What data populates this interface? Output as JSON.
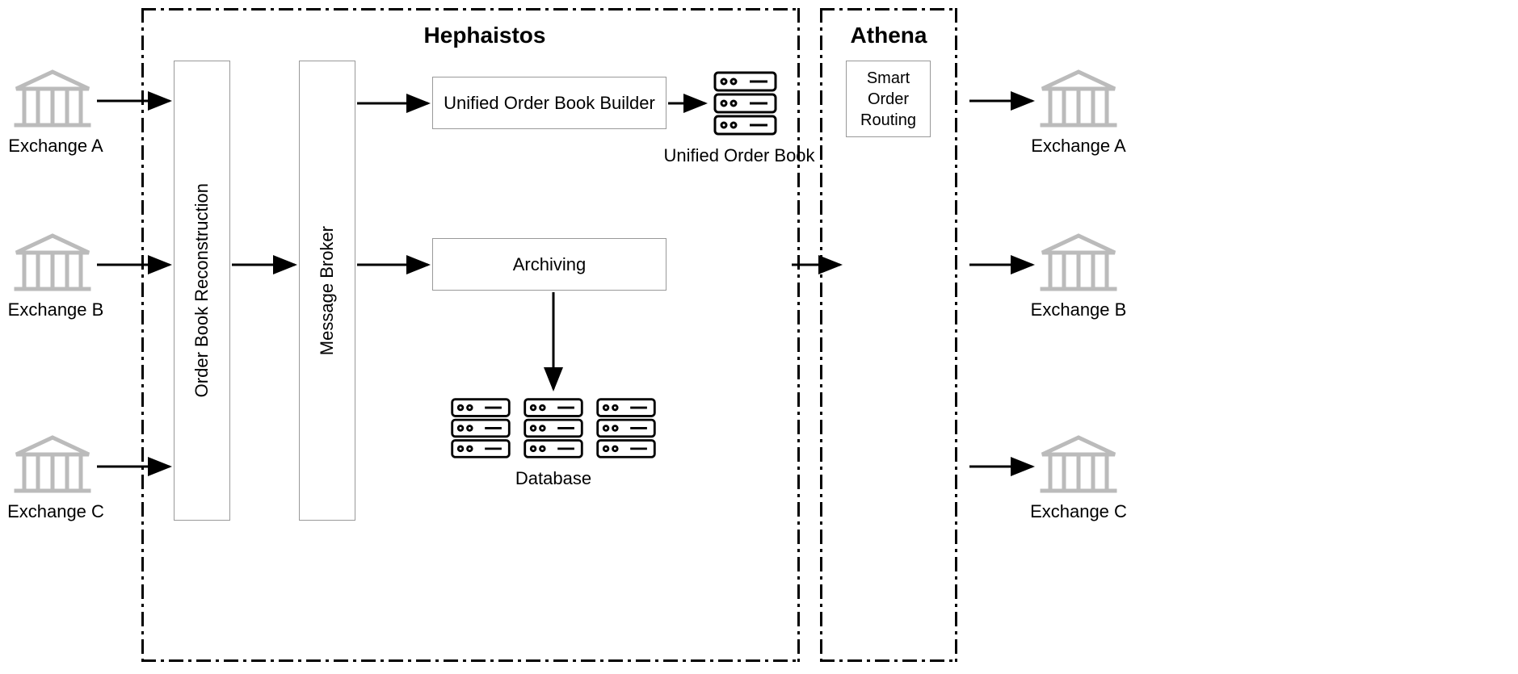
{
  "systems": {
    "hephaistos": {
      "title": "Hephaistos"
    },
    "athena": {
      "title": "Athena"
    }
  },
  "exchanges_left": [
    {
      "label": "Exchange A"
    },
    {
      "label": "Exchange B"
    },
    {
      "label": "Exchange C"
    }
  ],
  "exchanges_right": [
    {
      "label": "Exchange A"
    },
    {
      "label": "Exchange B"
    },
    {
      "label": "Exchange C"
    }
  ],
  "components": {
    "order_book_reconstruction": "Order Book Reconstruction",
    "message_broker": "Message Broker",
    "unified_order_book_builder": "Unified Order Book Builder",
    "archiving": "Archiving",
    "smart_order_routing": "Smart\nOrder\nRouting"
  },
  "labels": {
    "unified_order_book": "Unified Order Book",
    "database": "Database"
  }
}
